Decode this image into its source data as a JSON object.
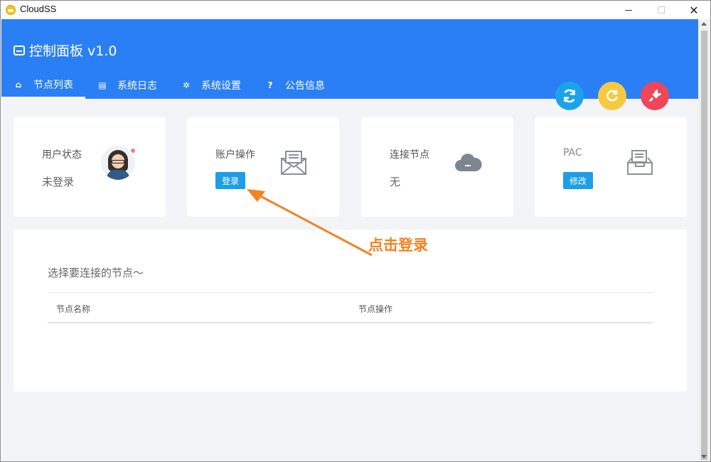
{
  "window": {
    "title": "CloudSS"
  },
  "header": {
    "title": "控制面板 v1.0"
  },
  "tabs": [
    {
      "label": "节点列表",
      "icon": "home-icon"
    },
    {
      "label": "系统日志",
      "icon": "log-icon"
    },
    {
      "label": "系统设置",
      "icon": "gear-icon"
    },
    {
      "label": "公告信息",
      "icon": "question-icon"
    }
  ],
  "actions": {
    "refresh": {
      "icon": "refresh-icon",
      "color": "#1aa3ea"
    },
    "reload": {
      "icon": "reload-icon",
      "color": "#f7c940"
    },
    "disconnect": {
      "icon": "plug-icon",
      "color": "#f0465a"
    }
  },
  "cards": {
    "user": {
      "label": "用户状态",
      "value": "未登录"
    },
    "account": {
      "label": "账户操作",
      "button": "登录"
    },
    "node": {
      "label": "连接节点",
      "value": "无"
    },
    "pac": {
      "label": "PAC",
      "button": "修改"
    }
  },
  "panel": {
    "title": "选择要连接的节点～",
    "columns": [
      "节点名称",
      "节点操作"
    ]
  },
  "annotation": {
    "text": "点击登录",
    "color": "#f18322"
  },
  "colors": {
    "header": "#2b7ff5",
    "primary_button": "#1d9ee8",
    "background": "#f3f4f8"
  }
}
